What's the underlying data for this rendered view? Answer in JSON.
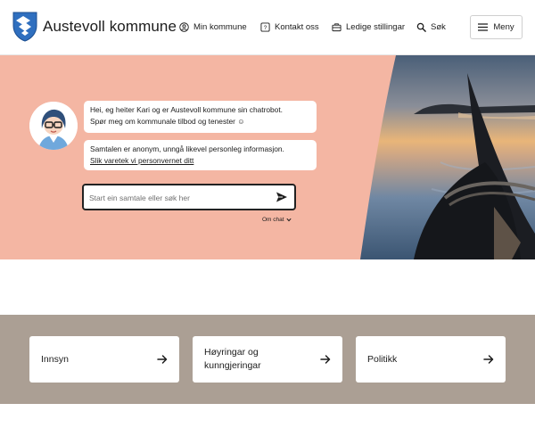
{
  "header": {
    "brand": "Austevoll kommune",
    "nav": [
      {
        "label": "Min kommune",
        "icon": "user-circle-icon"
      },
      {
        "label": "Kontakt oss",
        "icon": "chat-square-icon"
      },
      {
        "label": "Ledige stillingar",
        "icon": "briefcase-icon"
      },
      {
        "label": "Søk",
        "icon": "search-icon"
      }
    ],
    "menu_label": "Meny"
  },
  "chat": {
    "message_1_line_1": "Hei, eg heiter Kari og er Austevoll kommune sin chatrobot.",
    "message_1_line_2": "Spør meg om kommunale tilbod og tenester ☺",
    "message_2_line_1": "Samtalen er anonym, unngå likevel personleg informasjon.",
    "message_2_link": "Slik varetek vi personvernet ditt",
    "input_placeholder": "Start ein samtale eller søk her",
    "about_label": "Om chat"
  },
  "shortcuts": [
    {
      "line_1": "Innsyn",
      "line_2": ""
    },
    {
      "line_1": "Høyringar og",
      "line_2": "kunngjeringar"
    },
    {
      "line_1": "Politikk",
      "line_2": ""
    }
  ],
  "colors": {
    "hero_background": "#f4b6a3",
    "band_background": "#ab9f94",
    "logo_blue": "#2f6fbf"
  }
}
